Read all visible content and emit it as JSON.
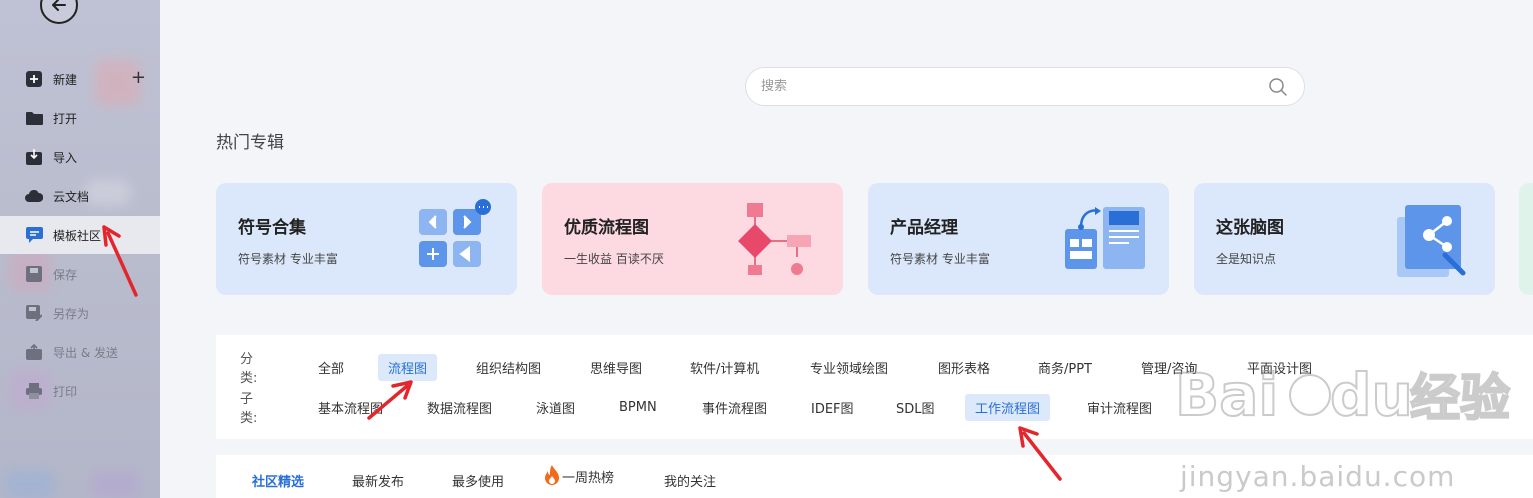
{
  "sidebar": {
    "items": [
      {
        "label": "新建",
        "icon": "plus-square-icon"
      },
      {
        "label": "打开",
        "icon": "folder-icon"
      },
      {
        "label": "导入",
        "icon": "import-icon"
      },
      {
        "label": "云文档",
        "icon": "cloud-icon"
      },
      {
        "label": "模板社区",
        "icon": "chat-bubble-icon"
      },
      {
        "label": "保存",
        "icon": "save-icon"
      },
      {
        "label": "另存为",
        "icon": "save-as-icon"
      },
      {
        "label": "导出 & 发送",
        "icon": "export-icon"
      },
      {
        "label": "打印",
        "icon": "print-icon"
      }
    ],
    "active_item": "模板社区"
  },
  "search": {
    "placeholder": "搜索"
  },
  "hot_section": {
    "title": "热门专辑"
  },
  "cards": [
    {
      "title": "符号合集",
      "subtitle": "符号素材 专业丰富",
      "bg": "#dbe8fb"
    },
    {
      "title": "优质流程图",
      "subtitle": "一生收益 百读不厌",
      "bg": "#fdd9e1"
    },
    {
      "title": "产品经理",
      "subtitle": "符号素材 专业丰富",
      "bg": "#dbe8fb"
    },
    {
      "title": "这张脑图",
      "subtitle": "全是知识点",
      "bg": "#dbe8fb"
    }
  ],
  "categories": {
    "label": "分类:",
    "items": [
      "全部",
      "流程图",
      "组织结构图",
      "思维导图",
      "软件/计算机",
      "专业领域绘图",
      "图形表格",
      "商务/PPT",
      "管理/咨询",
      "平面设计图"
    ],
    "selected": "流程图"
  },
  "subcategories": {
    "label": "子类:",
    "items": [
      "基本流程图",
      "数据流程图",
      "泳道图",
      "BPMN",
      "事件流程图",
      "IDEF图",
      "SDL图",
      "工作流程图",
      "审计流程图"
    ],
    "selected": "工作流程图"
  },
  "tabs": {
    "items": [
      "社区精选",
      "最新发布",
      "最多使用",
      "一周热榜",
      "我的关注"
    ],
    "active": "社区精选"
  },
  "watermark": {
    "brand": "Baidu经验",
    "url": "jingyan.baidu.com"
  },
  "colors": {
    "accent": "#2a6fd6",
    "annotation": "#e3262b"
  }
}
